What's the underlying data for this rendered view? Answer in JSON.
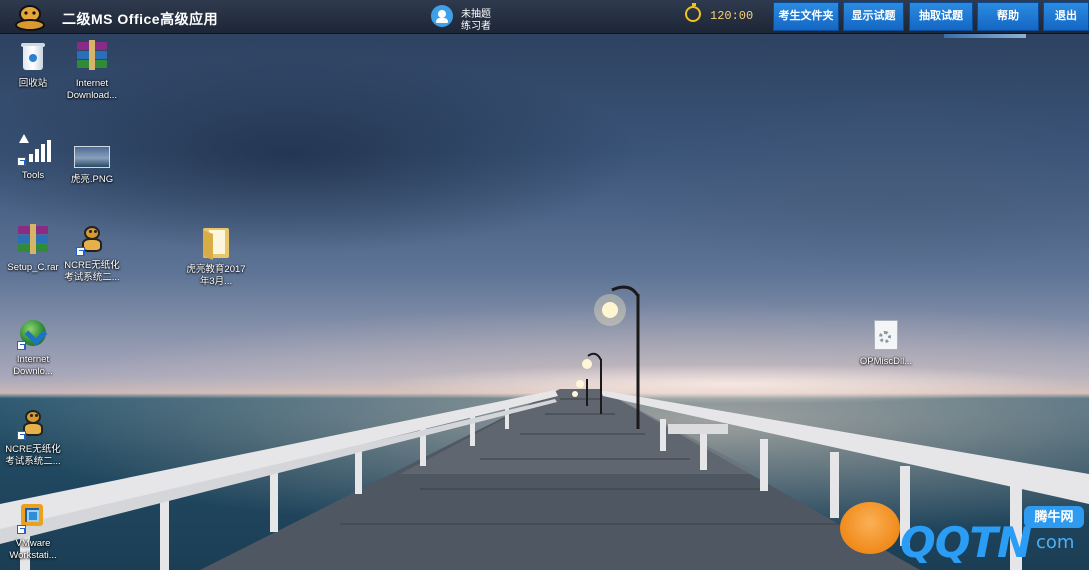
{
  "topbar": {
    "title": "二级MS Office高级应用",
    "user_line1": "未抽题",
    "user_line2": "练习者",
    "timer": "120:00",
    "buttons": {
      "examinee_folder": "考生文件夹",
      "show_question": "显示试题",
      "draw_question": "抽取试题",
      "help": "帮助",
      "quit": "退出"
    }
  },
  "desktop": {
    "icons": {
      "recycle_bin": "回收站",
      "internet_download_1": "Internet Download...",
      "tools": "Tools",
      "huke_png": "虎亮.PNG",
      "setup_rar": "Setup_C.rar",
      "ncre_1": "NCRE无纸化考试系统二...",
      "huke_folder": "虎亮教育2017年3月...",
      "internet_download_2": "Internet Downlo...",
      "ncre_2": "NCRE无纸化考试系统二...",
      "vmware": "VMware Workstati...",
      "opmisc": "OPMiscDll..."
    }
  },
  "watermark": {
    "brand": "QQTN",
    "suffix": "com",
    "badge": "腾牛网"
  },
  "colors": {
    "topbar": "#1d2636",
    "button_blue": "#1467c4",
    "timer_yellow": "#f0c21b",
    "watermark_blue": "#2b9df4",
    "watermark_orange": "#f08a1a"
  }
}
